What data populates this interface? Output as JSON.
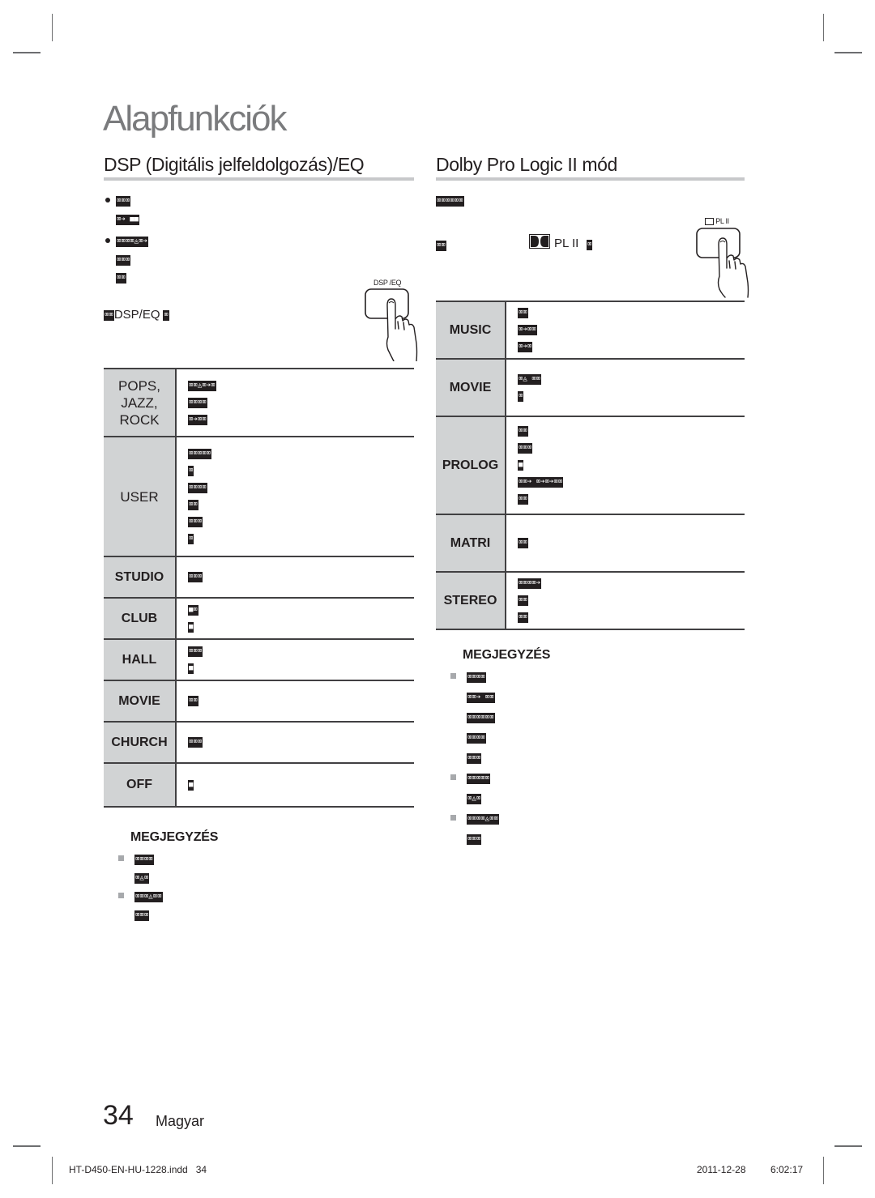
{
  "page": {
    "title": "Alapfunkciók",
    "number": "34",
    "language": "Magyar"
  },
  "left": {
    "heading": "DSP (Digitális jelfeldolgozás)/EQ",
    "bullets": [
      {
        "lines": [
          "⌧⌧⌧",
          "⌧➔ ■■"
        ]
      },
      {
        "lines": [
          "⌧⌧⌧⌧◬⌧➔",
          "⌧⌧⌧",
          "⌧⌧"
        ]
      }
    ],
    "instruction_prefix": "⌧⌧",
    "instruction_key": "DSP/EQ",
    "instruction_suffix": "⌧",
    "button_label": "DSP /EQ",
    "table": [
      {
        "mode": "POPS,\nJAZZ,\nROCK",
        "mode_lines": [
          "POPS,",
          "JAZZ,",
          "ROCK"
        ],
        "style": "light",
        "desc": [
          "⌧⌧◬⌧➔⌧",
          "⌧⌧⌧⌧",
          "⌧➔⌧⌧"
        ]
      },
      {
        "mode": "USER",
        "mode_lines": [
          "USER"
        ],
        "style": "light",
        "desc": [
          "⌧⌧⌧⌧⌧",
          "⌧",
          "⌧⌧⌧⌧",
          "⌧⌧",
          "⌧⌧⌧",
          "⌧"
        ]
      },
      {
        "mode": "STUDIO",
        "mode_lines": [
          "STUDIO"
        ],
        "style": "bold",
        "desc": [
          "⌧⌧⌧"
        ]
      },
      {
        "mode": "CLUB",
        "mode_lines": [
          "CLUB"
        ],
        "style": "bold",
        "desc": [
          "■⌧",
          "■"
        ]
      },
      {
        "mode": "HALL",
        "mode_lines": [
          "HALL"
        ],
        "style": "bold",
        "desc": [
          "⌧⌧⌧",
          "■"
        ]
      },
      {
        "mode": "MOVIE",
        "mode_lines": [
          "MOVIE"
        ],
        "style": "bold",
        "desc": [
          "⌧⌧"
        ]
      },
      {
        "mode": "CHURCH",
        "mode_lines": [
          "CHURCH"
        ],
        "style": "bold",
        "desc": [
          "⌧⌧⌧"
        ]
      },
      {
        "mode": "OFF",
        "mode_lines": [
          "OFF"
        ],
        "style": "bold",
        "desc": [
          "■"
        ]
      }
    ],
    "note": {
      "title": "MEGJEGYZÉS",
      "items": [
        {
          "lines": [
            "⌧⌧⌧⌧",
            "⌧◬⌧"
          ]
        },
        {
          "lines": [
            "⌧⌧⌧◬⌧⌧",
            "⌧⌧⌧"
          ]
        }
      ]
    }
  },
  "right": {
    "heading": "Dolby Pro Logic II mód",
    "intro": "⌧⌧⌧⌧⌧⌧",
    "instruction_prefix": "⌧⌧",
    "instruction_key": "PL II",
    "instruction_suffix": "⌧",
    "dolby_logo": "dolby-double-d",
    "button_label": "PL II",
    "table": [
      {
        "mode_lines": [
          "MUSIC"
        ],
        "desc": [
          "⌧⌧",
          "⌧➔⌧⌧",
          "⌧➔⌧"
        ]
      },
      {
        "mode_lines": [
          "MOVIE"
        ],
        "desc": [
          "⌧◬ ⌧⌧",
          "⌧"
        ]
      },
      {
        "mode_lines": [
          "PROLOG"
        ],
        "desc": [
          "⌧⌧",
          "⌧⌧⌧",
          "■",
          "⌧⌧➔ ⌧➔⌧➔⌧⌧",
          "⌧⌧"
        ]
      },
      {
        "mode_lines": [
          "MATRI"
        ],
        "desc": [
          "⌧⌧"
        ]
      },
      {
        "mode_lines": [
          "STEREO"
        ],
        "desc": [
          "⌧⌧⌧⌧➔",
          "⌧⌧",
          "⌧⌧"
        ]
      }
    ],
    "note": {
      "title": "MEGJEGYZÉS",
      "items": [
        {
          "lines": [
            "⌧⌧⌧⌧",
            "⌧⌧➔ ⌧⌧",
            "⌧⌧⌧⌧⌧⌧",
            "⌧⌧⌧⌧",
            "⌧⌧⌧"
          ]
        },
        {
          "lines": [
            "⌧⌧⌧⌧⌧",
            "⌧◬⌧"
          ]
        },
        {
          "lines": [
            "⌧⌧⌧⌧◬⌧⌧",
            "⌧⌧⌧"
          ]
        }
      ]
    }
  },
  "slug": {
    "file": "HT-D450-EN-HU-1228.indd   34",
    "date": "2011-12-28",
    "time": "6:02:17"
  }
}
